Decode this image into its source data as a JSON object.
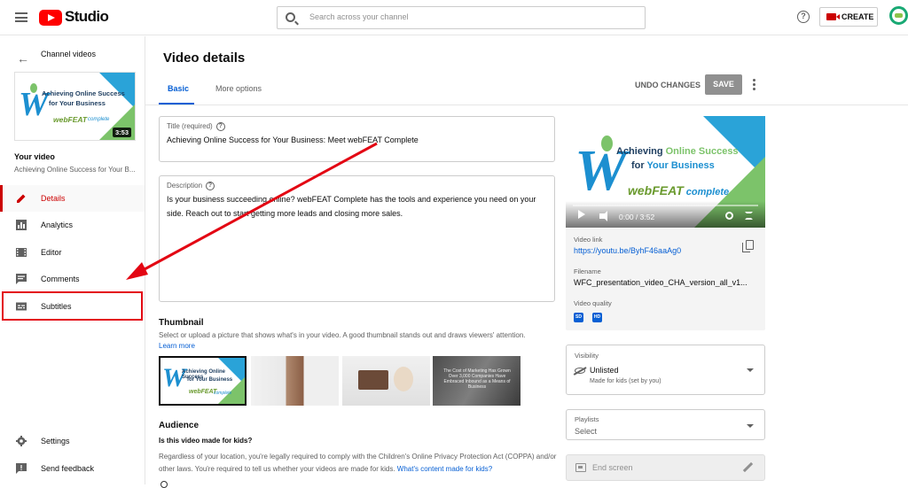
{
  "header": {
    "logo_text": "Studio",
    "search_placeholder": "Search across your channel",
    "create_label": "CREATE"
  },
  "sidebar": {
    "back_label": "Channel videos",
    "thumbnail": {
      "line1": "Achieving Online Success",
      "line2": "for Your Business",
      "brand": "webFEAT",
      "brand_suffix": "complete",
      "duration": "3:53"
    },
    "your_video_heading": "Your video",
    "video_title": "Achieving Online Success for Your B...",
    "nav": [
      {
        "label": "Details",
        "icon": "pencil-icon",
        "active": true
      },
      {
        "label": "Analytics",
        "icon": "bar-chart-icon",
        "active": false
      },
      {
        "label": "Editor",
        "icon": "film-icon",
        "active": false
      },
      {
        "label": "Comments",
        "icon": "comment-icon",
        "active": false
      },
      {
        "label": "Subtitles",
        "icon": "subtitles-icon",
        "active": false
      }
    ],
    "bottom": [
      {
        "label": "Settings",
        "icon": "gear-icon"
      },
      {
        "label": "Send feedback",
        "icon": "feedback-icon"
      }
    ]
  },
  "main": {
    "page_title": "Video details",
    "tabs": [
      {
        "label": "Basic",
        "active": true
      },
      {
        "label": "More options",
        "active": false
      }
    ],
    "undo_label": "UNDO CHANGES",
    "save_label": "SAVE",
    "title_field": {
      "label": "Title (required)",
      "value": "Achieving Online Success for Your Business: Meet webFEAT Complete"
    },
    "description_field": {
      "label": "Description",
      "value": "Is your business succeeding online? webFEAT Complete has the tools and experience you need on your side. Reach out to start getting more leads and closing more sales."
    },
    "thumbnail_section": {
      "title": "Thumbnail",
      "subtitle": "Select or upload a picture that shows what's in your video. A good thumbnail stands out and draws viewers' attention.",
      "learn_more": "Learn more",
      "option4_caption": "The Cost of Marketing Has Grown Over 3,000 Companies Have Embraced Inbound as a Means of Business"
    },
    "audience_section": {
      "title": "Audience",
      "question": "Is this video made for kids?",
      "body": "Regardless of your location, you're legally required to comply with the Children's Online Privacy Protection Act (COPPA) and/or other laws. You're required to tell us whether your videos are made for kids.",
      "link": "What's content made for kids?"
    }
  },
  "right_panel": {
    "player": {
      "line1a": "Achieving ",
      "line1b": "Online Success",
      "line2a": "for ",
      "line2b": "Your Business",
      "brand": "webFEAT",
      "brand_suffix": " complete",
      "time": "0:00 / 3:52"
    },
    "video_link_label": "Video link",
    "video_link": "https://youtu.be/ByhF46aaAg0",
    "filename_label": "Filename",
    "filename": "WFC_presentation_video_CHA_version_all_v1...",
    "quality_label": "Video quality",
    "quality_badges": [
      "SD",
      "HD"
    ],
    "visibility": {
      "label": "Visibility",
      "value": "Unlisted",
      "sub": "Made for kids (set by you)"
    },
    "playlists": {
      "label": "Playlists",
      "value": "Select"
    },
    "end_screen_label": "End screen"
  },
  "colors": {
    "accent_red": "#cc0000",
    "link_blue": "#065fd4",
    "annotation_red": "#e30613"
  }
}
